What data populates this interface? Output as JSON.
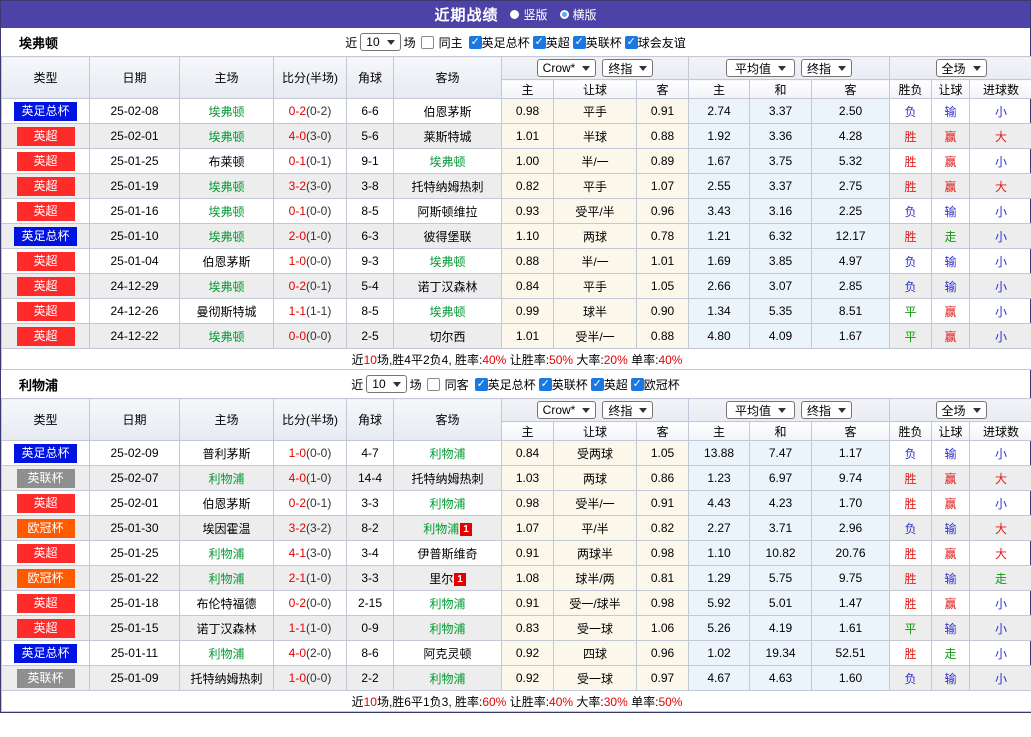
{
  "title_bar": {
    "title": "近期战绩",
    "radio_vertical": "竖版",
    "radio_horizontal": "横版"
  },
  "filters_common": {
    "near_label": "近",
    "match_count": "10",
    "unit_label": "场"
  },
  "columns": {
    "left": [
      "类型",
      "日期",
      "主场",
      "比分(半场)",
      "角球",
      "客场"
    ],
    "odds_sub": [
      "主",
      "让球",
      "客"
    ],
    "avg_sub": [
      "主",
      "和",
      "客"
    ],
    "result_sub": [
      "胜负",
      "让球",
      "进球数"
    ],
    "selects": {
      "odds_source": "Crow*",
      "odds_period": "终指",
      "avg_source": "平均值",
      "avg_period": "终指",
      "scope": "全场"
    }
  },
  "league_colors": {
    "英足总杯": "#0013e0",
    "英超": "#ff2b2b",
    "英联杯": "#8f8f8f",
    "欧冠杯": "#ff5a00"
  },
  "result_colors": {
    "胜": "#e01b1b",
    "负": "#3030cf",
    "平": "#0f9a0f",
    "赢": "#e01b1b",
    "输": "#3030cf",
    "走": "#0f9a0f",
    "大": "#e01b1b",
    "小": "#3030cf"
  },
  "sections": [
    {
      "team": "埃弗顿",
      "same_label": "同主",
      "leagues": [
        "英足总杯",
        "英超",
        "英联杯",
        "球会友谊"
      ],
      "rows": [
        {
          "league": "英足总杯",
          "date": "25-02-08",
          "home": "埃弗顿",
          "home_card": "",
          "score": "0-2",
          "half": "(0-2)",
          "corners": "6-6",
          "away": "伯恩茅斯",
          "away_card": "",
          "odds": [
            "0.98",
            "平手",
            "0.91"
          ],
          "avg": [
            "2.74",
            "3.37",
            "2.50"
          ],
          "results": [
            "负",
            "输",
            "小"
          ]
        },
        {
          "league": "英超",
          "date": "25-02-01",
          "home": "埃弗顿",
          "home_card": "",
          "score": "4-0",
          "half": "(3-0)",
          "corners": "5-6",
          "away": "莱斯特城",
          "away_card": "",
          "odds": [
            "1.01",
            "半球",
            "0.88"
          ],
          "avg": [
            "1.92",
            "3.36",
            "4.28"
          ],
          "results": [
            "胜",
            "赢",
            "大"
          ]
        },
        {
          "league": "英超",
          "date": "25-01-25",
          "home": "布莱顿",
          "home_card": "",
          "score": "0-1",
          "half": "(0-1)",
          "corners": "9-1",
          "away": "埃弗顿",
          "away_card": "",
          "odds": [
            "1.00",
            "半/一",
            "0.89"
          ],
          "avg": [
            "1.67",
            "3.75",
            "5.32"
          ],
          "results": [
            "胜",
            "赢",
            "小"
          ]
        },
        {
          "league": "英超",
          "date": "25-01-19",
          "home": "埃弗顿",
          "home_card": "",
          "score": "3-2",
          "half": "(3-0)",
          "corners": "3-8",
          "away": "托特纳姆热刺",
          "away_card": "",
          "odds": [
            "0.82",
            "平手",
            "1.07"
          ],
          "avg": [
            "2.55",
            "3.37",
            "2.75"
          ],
          "results": [
            "胜",
            "赢",
            "大"
          ]
        },
        {
          "league": "英超",
          "date": "25-01-16",
          "home": "埃弗顿",
          "home_card": "",
          "score": "0-1",
          "half": "(0-0)",
          "corners": "8-5",
          "away": "阿斯顿维拉",
          "away_card": "",
          "odds": [
            "0.93",
            "受平/半",
            "0.96"
          ],
          "avg": [
            "3.43",
            "3.16",
            "2.25"
          ],
          "results": [
            "负",
            "输",
            "小"
          ]
        },
        {
          "league": "英足总杯",
          "date": "25-01-10",
          "home": "埃弗顿",
          "home_card": "",
          "score": "2-0",
          "half": "(1-0)",
          "corners": "6-3",
          "away": "彼得堡联",
          "away_card": "",
          "odds": [
            "1.10",
            "两球",
            "0.78"
          ],
          "avg": [
            "1.21",
            "6.32",
            "12.17"
          ],
          "results": [
            "胜",
            "走",
            "小"
          ]
        },
        {
          "league": "英超",
          "date": "25-01-04",
          "home": "伯恩茅斯",
          "home_card": "",
          "score": "1-0",
          "half": "(0-0)",
          "corners": "9-3",
          "away": "埃弗顿",
          "away_card": "",
          "odds": [
            "0.88",
            "半/一",
            "1.01"
          ],
          "avg": [
            "1.69",
            "3.85",
            "4.97"
          ],
          "results": [
            "负",
            "输",
            "小"
          ]
        },
        {
          "league": "英超",
          "date": "24-12-29",
          "home": "埃弗顿",
          "home_card": "",
          "score": "0-2",
          "half": "(0-1)",
          "corners": "5-4",
          "away": "诺丁汉森林",
          "away_card": "",
          "odds": [
            "0.84",
            "平手",
            "1.05"
          ],
          "avg": [
            "2.66",
            "3.07",
            "2.85"
          ],
          "results": [
            "负",
            "输",
            "小"
          ]
        },
        {
          "league": "英超",
          "date": "24-12-26",
          "home": "曼彻斯特城",
          "home_card": "",
          "score": "1-1",
          "half": "(1-1)",
          "corners": "8-5",
          "away": "埃弗顿",
          "away_card": "",
          "odds": [
            "0.99",
            "球半",
            "0.90"
          ],
          "avg": [
            "1.34",
            "5.35",
            "8.51"
          ],
          "results": [
            "平",
            "赢",
            "小"
          ]
        },
        {
          "league": "英超",
          "date": "24-12-22",
          "home": "埃弗顿",
          "home_card": "",
          "score": "0-0",
          "half": "(0-0)",
          "corners": "2-5",
          "away": "切尔西",
          "away_card": "",
          "odds": [
            "1.01",
            "受半/一",
            "0.88"
          ],
          "avg": [
            "4.80",
            "4.09",
            "1.67"
          ],
          "results": [
            "平",
            "赢",
            "小"
          ]
        }
      ],
      "summary": [
        {
          "text": "近",
          "red": false
        },
        {
          "text": "10",
          "red": true
        },
        {
          "text": "场,胜4平2负4, 胜率:",
          "red": false
        },
        {
          "text": "40%",
          "red": true
        },
        {
          "text": " 让胜率:",
          "red": false
        },
        {
          "text": "50%",
          "red": true
        },
        {
          "text": " 大率:",
          "red": false
        },
        {
          "text": "20%",
          "red": true
        },
        {
          "text": " 单率:",
          "red": false
        },
        {
          "text": "40%",
          "red": true
        }
      ]
    },
    {
      "team": "利物浦",
      "same_label": "同客",
      "leagues": [
        "英足总杯",
        "英联杯",
        "英超",
        "欧冠杯"
      ],
      "rows": [
        {
          "league": "英足总杯",
          "date": "25-02-09",
          "home": "普利茅斯",
          "home_card": "",
          "score": "1-0",
          "half": "(0-0)",
          "corners": "4-7",
          "away": "利物浦",
          "away_card": "",
          "odds": [
            "0.84",
            "受两球",
            "1.05"
          ],
          "avg": [
            "13.88",
            "7.47",
            "1.17"
          ],
          "results": [
            "负",
            "输",
            "小"
          ]
        },
        {
          "league": "英联杯",
          "date": "25-02-07",
          "home": "利物浦",
          "home_card": "",
          "score": "4-0",
          "half": "(1-0)",
          "corners": "14-4",
          "away": "托特纳姆热刺",
          "away_card": "",
          "odds": [
            "1.03",
            "两球",
            "0.86"
          ],
          "avg": [
            "1.23",
            "6.97",
            "9.74"
          ],
          "results": [
            "胜",
            "赢",
            "大"
          ]
        },
        {
          "league": "英超",
          "date": "25-02-01",
          "home": "伯恩茅斯",
          "home_card": "",
          "score": "0-2",
          "half": "(0-1)",
          "corners": "3-3",
          "away": "利物浦",
          "away_card": "",
          "odds": [
            "0.98",
            "受半/一",
            "0.91"
          ],
          "avg": [
            "4.43",
            "4.23",
            "1.70"
          ],
          "results": [
            "胜",
            "赢",
            "小"
          ]
        },
        {
          "league": "欧冠杯",
          "date": "25-01-30",
          "home": "埃因霍温",
          "home_card": "",
          "score": "3-2",
          "half": "(3-2)",
          "corners": "8-2",
          "away": "利物浦",
          "away_card": "1",
          "odds": [
            "1.07",
            "平/半",
            "0.82"
          ],
          "avg": [
            "2.27",
            "3.71",
            "2.96"
          ],
          "results": [
            "负",
            "输",
            "大"
          ]
        },
        {
          "league": "英超",
          "date": "25-01-25",
          "home": "利物浦",
          "home_card": "",
          "score": "4-1",
          "half": "(3-0)",
          "corners": "3-4",
          "away": "伊普斯维奇",
          "away_card": "",
          "odds": [
            "0.91",
            "两球半",
            "0.98"
          ],
          "avg": [
            "1.10",
            "10.82",
            "20.76"
          ],
          "results": [
            "胜",
            "赢",
            "大"
          ]
        },
        {
          "league": "欧冠杯",
          "date": "25-01-22",
          "home": "利物浦",
          "home_card": "",
          "score": "2-1",
          "half": "(1-0)",
          "corners": "3-3",
          "away": "里尔",
          "away_card": "1",
          "odds": [
            "1.08",
            "球半/两",
            "0.81"
          ],
          "avg": [
            "1.29",
            "5.75",
            "9.75"
          ],
          "results": [
            "胜",
            "输",
            "走"
          ]
        },
        {
          "league": "英超",
          "date": "25-01-18",
          "home": "布伦特福德",
          "home_card": "",
          "score": "0-2",
          "half": "(0-0)",
          "corners": "2-15",
          "away": "利物浦",
          "away_card": "",
          "odds": [
            "0.91",
            "受一/球半",
            "0.98"
          ],
          "avg": [
            "5.92",
            "5.01",
            "1.47"
          ],
          "results": [
            "胜",
            "赢",
            "小"
          ]
        },
        {
          "league": "英超",
          "date": "25-01-15",
          "home": "诺丁汉森林",
          "home_card": "",
          "score": "1-1",
          "half": "(1-0)",
          "corners": "0-9",
          "away": "利物浦",
          "away_card": "",
          "odds": [
            "0.83",
            "受一球",
            "1.06"
          ],
          "avg": [
            "5.26",
            "4.19",
            "1.61"
          ],
          "results": [
            "平",
            "输",
            "小"
          ]
        },
        {
          "league": "英足总杯",
          "date": "25-01-11",
          "home": "利物浦",
          "home_card": "",
          "score": "4-0",
          "half": "(2-0)",
          "corners": "8-6",
          "away": "阿克灵顿",
          "away_card": "",
          "odds": [
            "0.92",
            "四球",
            "0.96"
          ],
          "avg": [
            "1.02",
            "19.34",
            "52.51"
          ],
          "results": [
            "胜",
            "走",
            "小"
          ]
        },
        {
          "league": "英联杯",
          "date": "25-01-09",
          "home": "托特纳姆热刺",
          "home_card": "",
          "score": "1-0",
          "half": "(0-0)",
          "corners": "2-2",
          "away": "利物浦",
          "away_card": "",
          "odds": [
            "0.92",
            "受一球",
            "0.97"
          ],
          "avg": [
            "4.67",
            "4.63",
            "1.60"
          ],
          "results": [
            "负",
            "输",
            "小"
          ]
        }
      ],
      "summary": [
        {
          "text": "近",
          "red": false
        },
        {
          "text": "10",
          "red": true
        },
        {
          "text": "场,胜6平1负3, 胜率:",
          "red": false
        },
        {
          "text": "60%",
          "red": true
        },
        {
          "text": " 让胜率:",
          "red": false
        },
        {
          "text": "40%",
          "red": true
        },
        {
          "text": " 大率:",
          "red": false
        },
        {
          "text": "30%",
          "red": true
        },
        {
          "text": " 单率:",
          "red": false
        },
        {
          "text": "50%",
          "red": true
        }
      ]
    }
  ]
}
